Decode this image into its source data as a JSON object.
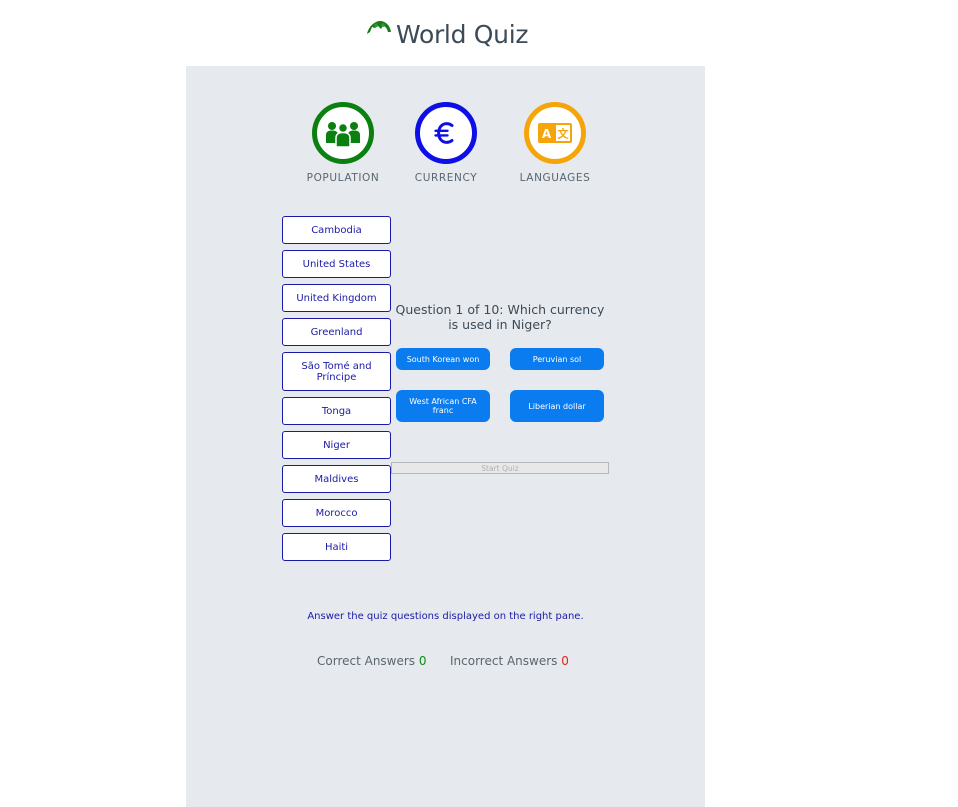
{
  "header": {
    "logo_icon": "globe-icon",
    "title": "World Quiz",
    "brand_color": "#1a7a1a"
  },
  "categories": [
    {
      "label": "POPULATION",
      "icon": "people-icon",
      "color": "#0b8010"
    },
    {
      "label": "CURRENCY",
      "icon": "euro-icon",
      "color": "#0e0ee6"
    },
    {
      "label": "LANGUAGES",
      "icon": "translate-icon",
      "color": "#f5a40a"
    }
  ],
  "countries": [
    "Cambodia",
    "United States",
    "United Kingdom",
    "Greenland",
    "São Tomé and Príncipe",
    "Tonga",
    "Niger",
    "Maldives",
    "Morocco",
    "Haiti"
  ],
  "quiz": {
    "question": "Question 1 of 10: Which currency is used in Niger?",
    "answers": [
      "South Korean won",
      "Peruvian sol",
      "West African CFA franc",
      "Liberian dollar"
    ],
    "start_label": "Start Quiz",
    "answer_color": "#0a7cf0"
  },
  "footer": {
    "instruction": "Answer the quiz questions displayed on the right pane.",
    "correct_label": "Correct Answers",
    "correct_count": "0",
    "incorrect_label": "Incorrect Answers",
    "incorrect_count": "0"
  }
}
